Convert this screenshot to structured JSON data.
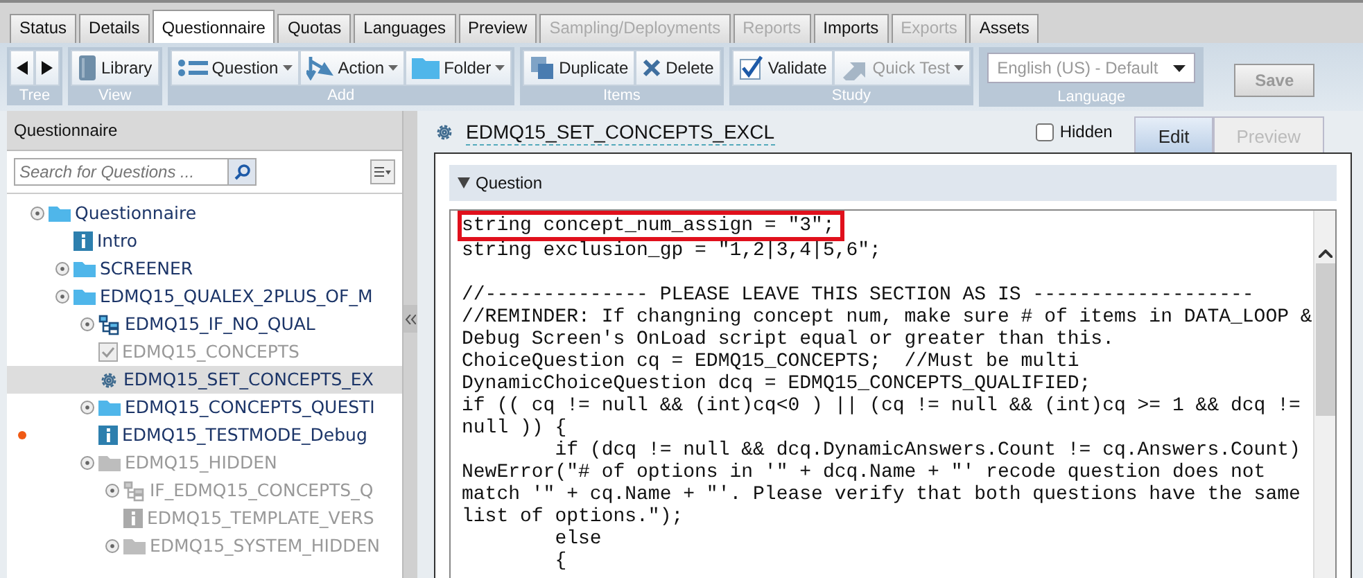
{
  "tabs": [
    {
      "label": "Status",
      "selected": false,
      "disabled": false
    },
    {
      "label": "Details",
      "selected": false,
      "disabled": false
    },
    {
      "label": "Questionnaire",
      "selected": true,
      "disabled": false
    },
    {
      "label": "Quotas",
      "selected": false,
      "disabled": false
    },
    {
      "label": "Languages",
      "selected": false,
      "disabled": false
    },
    {
      "label": "Preview",
      "selected": false,
      "disabled": false
    },
    {
      "label": "Sampling/Deployments",
      "selected": false,
      "disabled": true
    },
    {
      "label": "Reports",
      "selected": false,
      "disabled": true
    },
    {
      "label": "Imports",
      "selected": false,
      "disabled": false
    },
    {
      "label": "Exports",
      "selected": false,
      "disabled": true
    },
    {
      "label": "Assets",
      "selected": false,
      "disabled": false
    }
  ],
  "toolbar": [
    {
      "label": "Tree",
      "kind": "nav"
    },
    {
      "label": "View",
      "kind": "buttons",
      "buttons": [
        {
          "label": "Library",
          "kind": "book",
          "dropdown": false,
          "disabled": false
        }
      ]
    },
    {
      "label": "Add",
      "kind": "buttons",
      "buttons": [
        {
          "label": "Question",
          "kind": "list",
          "dropdown": true,
          "disabled": false
        },
        {
          "label": "Action",
          "kind": "action",
          "dropdown": true,
          "disabled": false
        },
        {
          "label": "Folder",
          "kind": "folder",
          "dropdown": true,
          "disabled": false
        }
      ]
    },
    {
      "label": "Items",
      "kind": "buttons",
      "buttons": [
        {
          "label": "Duplicate",
          "kind": "copy",
          "dropdown": false,
          "disabled": false
        },
        {
          "label": "Delete",
          "kind": "x",
          "dropdown": false,
          "disabled": false
        }
      ]
    },
    {
      "label": "Study",
      "kind": "buttons",
      "buttons": [
        {
          "label": "Validate",
          "kind": "check",
          "dropdown": false,
          "disabled": false
        },
        {
          "label": "Quick Test",
          "kind": "arrow",
          "dropdown": true,
          "disabled": true
        }
      ]
    },
    {
      "label": "Language",
      "kind": "select",
      "value": "English (US) - Default",
      "disabled": true
    }
  ],
  "save_button": {
    "label": "Save",
    "disabled": true
  },
  "sidebar": {
    "title": "Questionnaire",
    "search": {
      "placeholder": "Search for Questions ..."
    },
    "tree": [
      {
        "label": "Questionnaire",
        "kind": "folder",
        "toggle": true,
        "disabled": false,
        "selected": false,
        "children": [
          {
            "label": "Intro",
            "kind": "info",
            "toggle": false,
            "disabled": false,
            "selected": false
          },
          {
            "label": "SCREENER",
            "kind": "folder",
            "toggle": true,
            "disabled": false,
            "selected": false
          },
          {
            "label": "EDMQ15_QUALEX_2PLUS_OF_M",
            "kind": "folder",
            "toggle": true,
            "disabled": false,
            "selected": false,
            "children": [
              {
                "label": "EDMQ15_IF_NO_QUAL",
                "kind": "branch",
                "toggle": true,
                "disabled": false,
                "selected": false
              },
              {
                "label": "EDMQ15_CONCEPTS",
                "kind": "checkbox",
                "toggle": false,
                "disabled": true,
                "selected": false
              },
              {
                "label": "EDMQ15_SET_CONCEPTS_EX",
                "kind": "gear",
                "toggle": false,
                "disabled": false,
                "selected": true
              },
              {
                "label": "EDMQ15_CONCEPTS_QUESTI",
                "kind": "folder",
                "toggle": true,
                "disabled": false,
                "selected": false
              },
              {
                "label": "EDMQ15_TESTMODE_Debug",
                "kind": "info",
                "toggle": false,
                "disabled": false,
                "selected": false,
                "flagged": true
              },
              {
                "label": "EDMQ15_HIDDEN",
                "kind": "folder",
                "toggle": true,
                "disabled": true,
                "selected": false,
                "children": [
                  {
                    "label": "IF_EDMQ15_CONCEPTS_Q",
                    "kind": "branch",
                    "toggle": true,
                    "disabled": true,
                    "selected": false
                  },
                  {
                    "label": "EDMQ15_TEMPLATE_VERS",
                    "kind": "info",
                    "toggle": false,
                    "disabled": true,
                    "selected": false
                  },
                  {
                    "label": "EDMQ15_SYSTEM_HIDDEN",
                    "kind": "folder",
                    "toggle": true,
                    "disabled": true,
                    "selected": false
                  }
                ]
              }
            ]
          }
        ]
      }
    ]
  },
  "editor": {
    "title": "EDMQ15_SET_CONCEPTS_EXCL",
    "hidden_checkbox": {
      "label": "Hidden",
      "checked": false
    },
    "view_tabs": [
      {
        "label": "Edit",
        "selected": true,
        "disabled": false
      },
      {
        "label": "Preview",
        "selected": false,
        "disabled": true
      }
    ],
    "section": {
      "title": "Question",
      "expanded": true
    },
    "code_lines": [
      {
        "text": "string concept_num_assign = \"3\";",
        "highlighted": true
      },
      {
        "text": "string exclusion_gp = \"1,2|3,4|5,6\";",
        "highlighted": false
      },
      {
        "text": "//-------------- PLEASE LEAVE THIS SECTION AS IS -------------------",
        "highlighted": false,
        "blank_line_before": true
      },
      {
        "text": "//REMINDER: If changning concept num, make sure # of items in DATA_LOOP &",
        "highlighted": false
      },
      {
        "text": "Debug Screen's OnLoad script equal or greater than this.",
        "highlighted": false
      },
      {
        "text": "ChoiceQuestion cq = EDMQ15_CONCEPTS;  //Must be multi",
        "highlighted": false
      },
      {
        "text": "DynamicChoiceQuestion dcq = EDMQ15_CONCEPTS_QUALIFIED;",
        "highlighted": false
      },
      {
        "text": "if (( cq != null && (int)cq<0 ) || (cq != null && (int)cq >= 1 && dcq !=",
        "highlighted": false
      },
      {
        "text": "null )) {",
        "highlighted": false
      },
      {
        "text": "        if (dcq != null && dcq.DynamicAnswers.Count != cq.Answers.Count)",
        "highlighted": false
      },
      {
        "text": "NewError(\"# of options in '\" + dcq.Name + \"' recode question does not",
        "highlighted": false
      },
      {
        "text": "match '\" + cq.Name + \"'. Please verify that both questions have the same",
        "highlighted": false
      },
      {
        "text": "list of options.\");",
        "highlighted": false
      },
      {
        "text": "        else",
        "highlighted": false
      },
      {
        "text": "        {",
        "highlighted": false
      }
    ]
  }
}
